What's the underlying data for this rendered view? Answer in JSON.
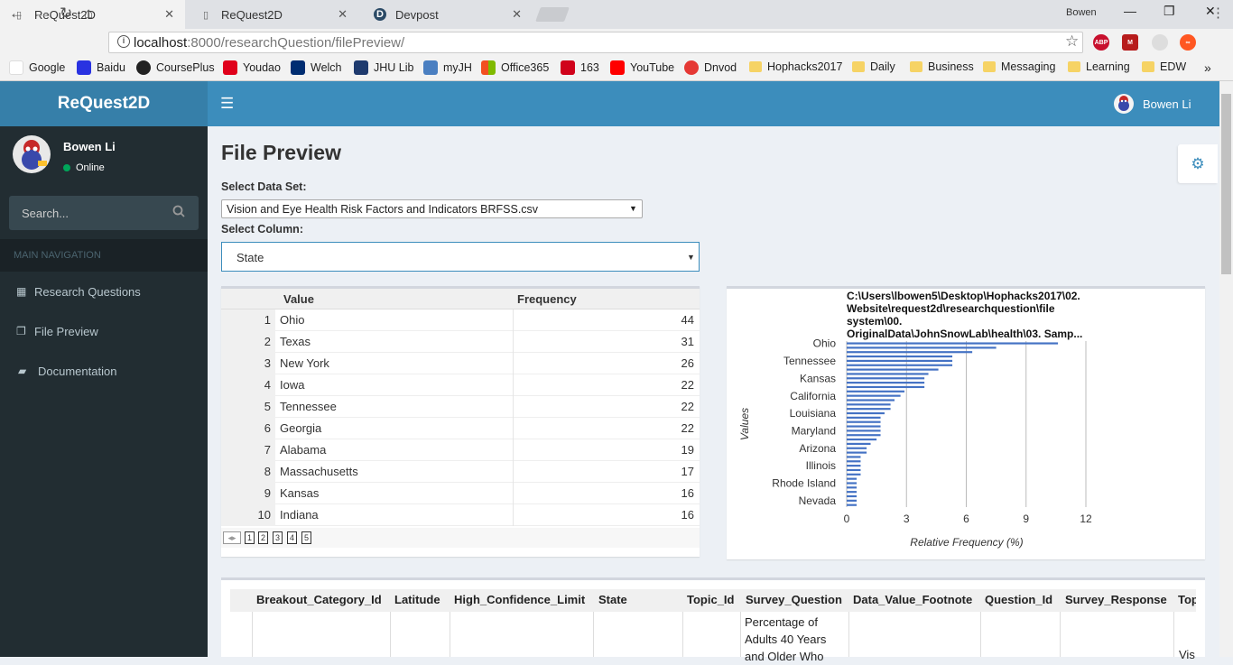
{
  "browser": {
    "tabs": [
      {
        "title": "ReQuest2D",
        "active": true
      },
      {
        "title": "ReQuest2D",
        "active": false
      },
      {
        "title": "Devpost",
        "active": false
      }
    ],
    "profile_name": "Bowen",
    "url_host": "localhost",
    "url_rest": ":8000/researchQuestion/filePreview/",
    "bookmarks": [
      "Google",
      "Baidu",
      "CoursePlus",
      "Youdao",
      "Welch",
      "JHU Lib",
      "myJH",
      "Office365",
      "163",
      "YouTube",
      "Dnvod",
      "Hophacks2017",
      "Daily",
      "Business",
      "Messaging",
      "Learning",
      "EDW"
    ],
    "more": "»"
  },
  "app": {
    "logo": "ReQuest2D",
    "user_name": "Bowen Li",
    "status": "Online",
    "search_placeholder": "Search...",
    "nav_header": "MAIN NAVIGATION",
    "nav_items": [
      "Research Questions",
      "File Preview",
      "Documentation"
    ],
    "accent_color": "#3c8dbc"
  },
  "page": {
    "title": "File Preview",
    "dataset_label": "Select Data Set:",
    "dataset_value": "Vision and Eye Health Risk Factors and Indicators BRFSS.csv",
    "column_label": "Select Column:",
    "column_value": "State"
  },
  "freq_table": {
    "headers": [
      "Value",
      "Frequency"
    ],
    "rows": [
      {
        "idx": "1",
        "value": "Ohio",
        "freq": "44"
      },
      {
        "idx": "2",
        "value": "Texas",
        "freq": "31"
      },
      {
        "idx": "3",
        "value": "New York",
        "freq": "26"
      },
      {
        "idx": "4",
        "value": "Iowa",
        "freq": "22"
      },
      {
        "idx": "5",
        "value": "Tennessee",
        "freq": "22"
      },
      {
        "idx": "6",
        "value": "Georgia",
        "freq": "22"
      },
      {
        "idx": "7",
        "value": "Alabama",
        "freq": "19"
      },
      {
        "idx": "8",
        "value": "Massachusetts",
        "freq": "17"
      },
      {
        "idx": "9",
        "value": "Kansas",
        "freq": "16"
      },
      {
        "idx": "10",
        "value": "Indiana",
        "freq": "16"
      }
    ],
    "pages": [
      "1",
      "2",
      "3",
      "4",
      "5"
    ]
  },
  "chart_data": {
    "type": "bar",
    "orientation": "horizontal",
    "title": "C:\\Users\\lbowen5\\Desktop\\Hophacks2017\\02. Website\\request2d\\researchquestion\\file system\\00. OriginalData\\JohnSnowLab\\health\\03. Samp...",
    "title_lines": [
      "C:\\Users\\lbowen5\\Desktop\\Hophacks2017\\02.",
      "Website\\request2d\\researchquestion\\file",
      "system\\00.",
      "OriginalData\\JohnSnowLab\\health\\03. Samp..."
    ],
    "xlabel": "Relative Frequency (%)",
    "ylabel": "Values",
    "xlim": [
      0,
      12
    ],
    "xticks": [
      "0",
      "3",
      "6",
      "9",
      "12"
    ],
    "ytick_labels": [
      "Ohio",
      "Tennessee",
      "Kansas",
      "California",
      "Louisiana",
      "Maryland",
      "Arizona",
      "Illinois",
      "Rhode Island",
      "Nevada"
    ],
    "values": [
      10.6,
      7.5,
      6.3,
      5.3,
      5.3,
      5.3,
      4.6,
      4.1,
      3.9,
      3.9,
      3.9,
      2.9,
      2.7,
      2.4,
      2.2,
      2.2,
      1.9,
      1.7,
      1.7,
      1.7,
      1.7,
      1.7,
      1.5,
      1.2,
      1.0,
      1.0,
      0.7,
      0.7,
      0.7,
      0.7,
      0.7,
      0.5,
      0.5,
      0.5,
      0.5,
      0.5,
      0.5,
      0.5
    ],
    "bar_color": "#4472c4",
    "grid": true
  },
  "bottom_table": {
    "headers": [
      "Breakout_Category_Id",
      "Latitude",
      "High_Confidence_Limit",
      "State",
      "Topic_Id",
      "Survey_Question",
      "Data_Value_Footnote",
      "Question_Id",
      "Survey_Response",
      "Top"
    ],
    "survey_question_cell": "Percentage of Adults 40 Years and Older Who",
    "last_cell": "Vis"
  }
}
